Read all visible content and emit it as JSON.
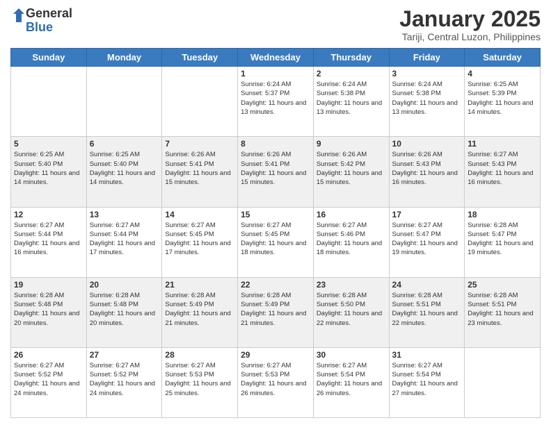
{
  "logo": {
    "general": "General",
    "blue": "Blue"
  },
  "header": {
    "month": "January 2025",
    "location": "Tariji, Central Luzon, Philippines"
  },
  "days_of_week": [
    "Sunday",
    "Monday",
    "Tuesday",
    "Wednesday",
    "Thursday",
    "Friday",
    "Saturday"
  ],
  "weeks": [
    [
      {
        "day": "",
        "sunrise": "",
        "sunset": "",
        "daylight": ""
      },
      {
        "day": "",
        "sunrise": "",
        "sunset": "",
        "daylight": ""
      },
      {
        "day": "",
        "sunrise": "",
        "sunset": "",
        "daylight": ""
      },
      {
        "day": "1",
        "sunrise": "Sunrise: 6:24 AM",
        "sunset": "Sunset: 5:37 PM",
        "daylight": "Daylight: 11 hours and 13 minutes."
      },
      {
        "day": "2",
        "sunrise": "Sunrise: 6:24 AM",
        "sunset": "Sunset: 5:38 PM",
        "daylight": "Daylight: 11 hours and 13 minutes."
      },
      {
        "day": "3",
        "sunrise": "Sunrise: 6:24 AM",
        "sunset": "Sunset: 5:38 PM",
        "daylight": "Daylight: 11 hours and 13 minutes."
      },
      {
        "day": "4",
        "sunrise": "Sunrise: 6:25 AM",
        "sunset": "Sunset: 5:39 PM",
        "daylight": "Daylight: 11 hours and 14 minutes."
      }
    ],
    [
      {
        "day": "5",
        "sunrise": "Sunrise: 6:25 AM",
        "sunset": "Sunset: 5:40 PM",
        "daylight": "Daylight: 11 hours and 14 minutes."
      },
      {
        "day": "6",
        "sunrise": "Sunrise: 6:25 AM",
        "sunset": "Sunset: 5:40 PM",
        "daylight": "Daylight: 11 hours and 14 minutes."
      },
      {
        "day": "7",
        "sunrise": "Sunrise: 6:26 AM",
        "sunset": "Sunset: 5:41 PM",
        "daylight": "Daylight: 11 hours and 15 minutes."
      },
      {
        "day": "8",
        "sunrise": "Sunrise: 6:26 AM",
        "sunset": "Sunset: 5:41 PM",
        "daylight": "Daylight: 11 hours and 15 minutes."
      },
      {
        "day": "9",
        "sunrise": "Sunrise: 6:26 AM",
        "sunset": "Sunset: 5:42 PM",
        "daylight": "Daylight: 11 hours and 15 minutes."
      },
      {
        "day": "10",
        "sunrise": "Sunrise: 6:26 AM",
        "sunset": "Sunset: 5:43 PM",
        "daylight": "Daylight: 11 hours and 16 minutes."
      },
      {
        "day": "11",
        "sunrise": "Sunrise: 6:27 AM",
        "sunset": "Sunset: 5:43 PM",
        "daylight": "Daylight: 11 hours and 16 minutes."
      }
    ],
    [
      {
        "day": "12",
        "sunrise": "Sunrise: 6:27 AM",
        "sunset": "Sunset: 5:44 PM",
        "daylight": "Daylight: 11 hours and 16 minutes."
      },
      {
        "day": "13",
        "sunrise": "Sunrise: 6:27 AM",
        "sunset": "Sunset: 5:44 PM",
        "daylight": "Daylight: 11 hours and 17 minutes."
      },
      {
        "day": "14",
        "sunrise": "Sunrise: 6:27 AM",
        "sunset": "Sunset: 5:45 PM",
        "daylight": "Daylight: 11 hours and 17 minutes."
      },
      {
        "day": "15",
        "sunrise": "Sunrise: 6:27 AM",
        "sunset": "Sunset: 5:45 PM",
        "daylight": "Daylight: 11 hours and 18 minutes."
      },
      {
        "day": "16",
        "sunrise": "Sunrise: 6:27 AM",
        "sunset": "Sunset: 5:46 PM",
        "daylight": "Daylight: 11 hours and 18 minutes."
      },
      {
        "day": "17",
        "sunrise": "Sunrise: 6:27 AM",
        "sunset": "Sunset: 5:47 PM",
        "daylight": "Daylight: 11 hours and 19 minutes."
      },
      {
        "day": "18",
        "sunrise": "Sunrise: 6:28 AM",
        "sunset": "Sunset: 5:47 PM",
        "daylight": "Daylight: 11 hours and 19 minutes."
      }
    ],
    [
      {
        "day": "19",
        "sunrise": "Sunrise: 6:28 AM",
        "sunset": "Sunset: 5:48 PM",
        "daylight": "Daylight: 11 hours and 20 minutes."
      },
      {
        "day": "20",
        "sunrise": "Sunrise: 6:28 AM",
        "sunset": "Sunset: 5:48 PM",
        "daylight": "Daylight: 11 hours and 20 minutes."
      },
      {
        "day": "21",
        "sunrise": "Sunrise: 6:28 AM",
        "sunset": "Sunset: 5:49 PM",
        "daylight": "Daylight: 11 hours and 21 minutes."
      },
      {
        "day": "22",
        "sunrise": "Sunrise: 6:28 AM",
        "sunset": "Sunset: 5:49 PM",
        "daylight": "Daylight: 11 hours and 21 minutes."
      },
      {
        "day": "23",
        "sunrise": "Sunrise: 6:28 AM",
        "sunset": "Sunset: 5:50 PM",
        "daylight": "Daylight: 11 hours and 22 minutes."
      },
      {
        "day": "24",
        "sunrise": "Sunrise: 6:28 AM",
        "sunset": "Sunset: 5:51 PM",
        "daylight": "Daylight: 11 hours and 22 minutes."
      },
      {
        "day": "25",
        "sunrise": "Sunrise: 6:28 AM",
        "sunset": "Sunset: 5:51 PM",
        "daylight": "Daylight: 11 hours and 23 minutes."
      }
    ],
    [
      {
        "day": "26",
        "sunrise": "Sunrise: 6:27 AM",
        "sunset": "Sunset: 5:52 PM",
        "daylight": "Daylight: 11 hours and 24 minutes."
      },
      {
        "day": "27",
        "sunrise": "Sunrise: 6:27 AM",
        "sunset": "Sunset: 5:52 PM",
        "daylight": "Daylight: 11 hours and 24 minutes."
      },
      {
        "day": "28",
        "sunrise": "Sunrise: 6:27 AM",
        "sunset": "Sunset: 5:53 PM",
        "daylight": "Daylight: 11 hours and 25 minutes."
      },
      {
        "day": "29",
        "sunrise": "Sunrise: 6:27 AM",
        "sunset": "Sunset: 5:53 PM",
        "daylight": "Daylight: 11 hours and 26 minutes."
      },
      {
        "day": "30",
        "sunrise": "Sunrise: 6:27 AM",
        "sunset": "Sunset: 5:54 PM",
        "daylight": "Daylight: 11 hours and 26 minutes."
      },
      {
        "day": "31",
        "sunrise": "Sunrise: 6:27 AM",
        "sunset": "Sunset: 5:54 PM",
        "daylight": "Daylight: 11 hours and 27 minutes."
      },
      {
        "day": "",
        "sunrise": "",
        "sunset": "",
        "daylight": ""
      }
    ]
  ]
}
